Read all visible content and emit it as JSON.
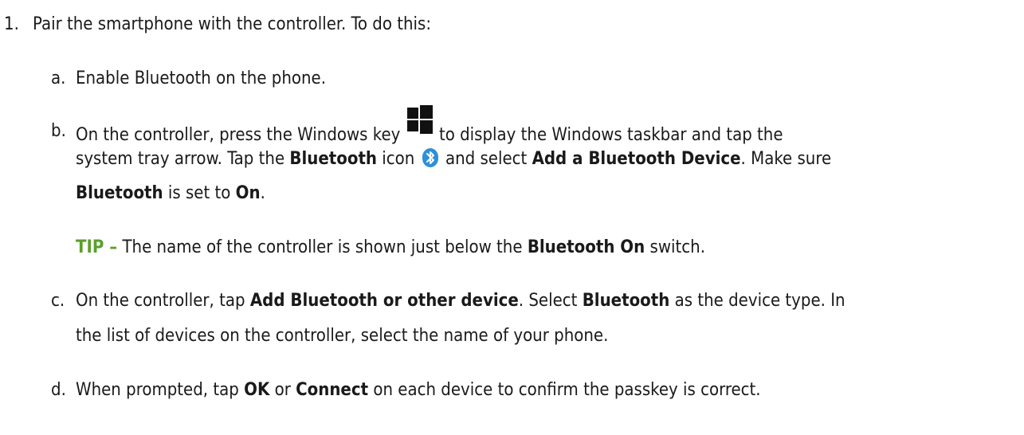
{
  "step1": {
    "number": "1.",
    "text": "Pair the smartphone with the controller. To do this:"
  },
  "step_a": {
    "letter": "a.",
    "text": "Enable Bluetooth on the phone."
  },
  "step_b": {
    "letter": "b.",
    "l1_pre": "On the controller, press the Windows key",
    "l1_post": "to display the Windows taskbar and tap the",
    "l2_pre": "system tray arrow. Tap the ",
    "l2_b1": "Bluetooth",
    "l2_mid": " icon",
    "l2_post": "and select ",
    "l2_b2": "Add a Bluetooth Device",
    "l2_end": ". Make sure",
    "l3_b1": "Bluetooth",
    "l3_mid": " is set to ",
    "l3_b2": "On",
    "l3_end": "."
  },
  "tip": {
    "label": "TIP –",
    "pre": " The name of the controller is shown just below the ",
    "bold": "Bluetooth On",
    "post": " switch."
  },
  "step_c": {
    "letter": "c.",
    "l1_pre": "On the controller, tap ",
    "l1_b1": "Add Bluetooth or other device",
    "l1_mid": ". Select ",
    "l1_b2": "Bluetooth",
    "l1_post": " as the device type. In",
    "l2": "the list of devices on the controller, select the name of your phone."
  },
  "step_d": {
    "letter": "d.",
    "pre": "When prompted, tap ",
    "b1": "OK",
    "mid": " or ",
    "b2": "Connect",
    "post": " on each device to confirm the passkey is correct."
  },
  "colors": {
    "text": "#1a1a1a",
    "tip": "#5aa02c",
    "bluetooth_badge": "#2f8fd8"
  },
  "icons": [
    "windows-key-icon",
    "bluetooth-icon"
  ]
}
